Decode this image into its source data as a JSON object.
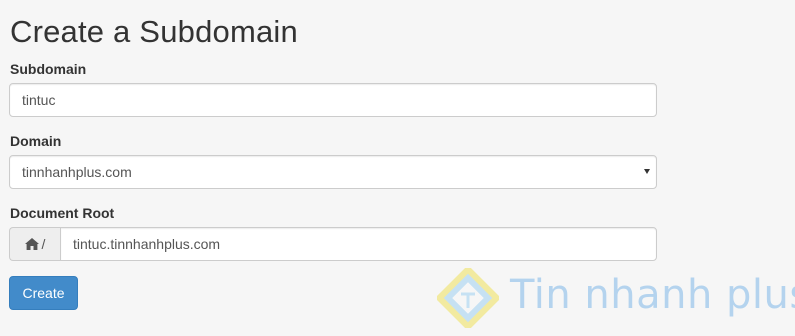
{
  "page": {
    "title": "Create a Subdomain"
  },
  "form": {
    "subdomain": {
      "label": "Subdomain",
      "value": "tintuc"
    },
    "domain": {
      "label": "Domain",
      "selected": "tinnhanhplus.com"
    },
    "document_root": {
      "label": "Document Root",
      "prefix": "/",
      "value": "tintuc.tinnhanhplus.com"
    },
    "submit_label": "Create"
  },
  "watermark": {
    "text": "Tin nhanh plus"
  },
  "colors": {
    "primary_button": "#428bca",
    "background": "#f6f6f6"
  }
}
